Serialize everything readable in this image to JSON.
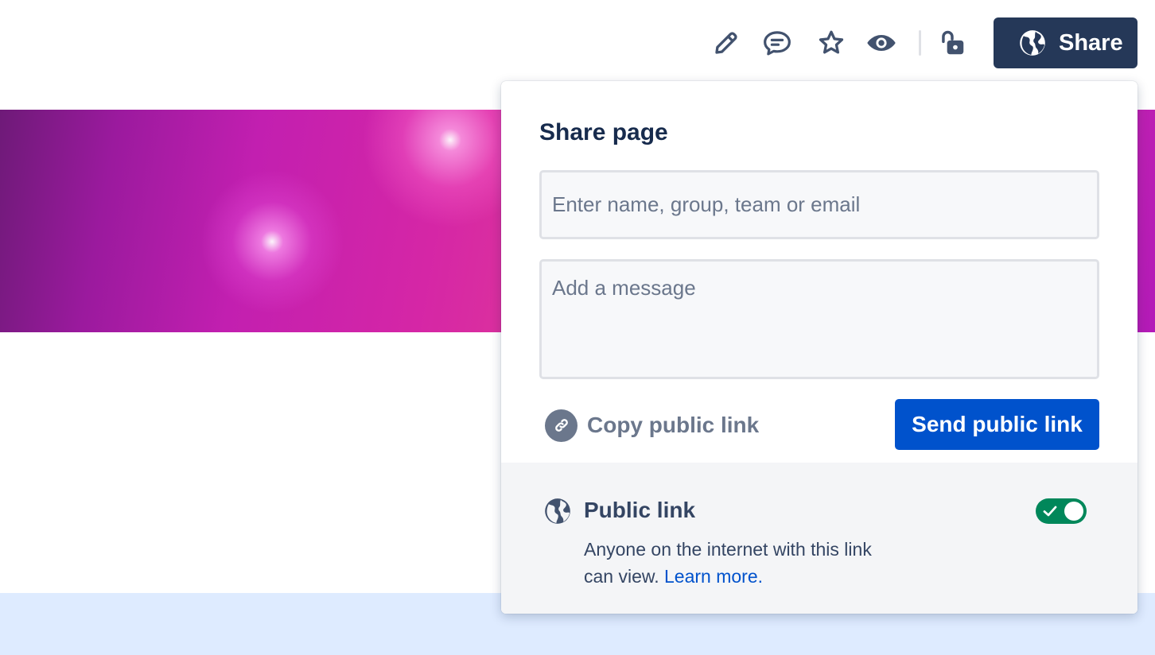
{
  "toolbar": {
    "icons": [
      "pencil-icon",
      "comment-icon",
      "star-icon",
      "eye-icon",
      "unlock-icon"
    ],
    "share_label": "Share"
  },
  "share_dialog": {
    "title": "Share page",
    "recipient_placeholder": "Enter name, group, team or email",
    "message_placeholder": "Add a message",
    "copy_link_label": "Copy public link",
    "send_button_label": "Send public link",
    "public_link": {
      "title": "Public link",
      "description": "Anyone on the internet with this link can view.",
      "learn_more": "Learn more.",
      "enabled": true
    }
  },
  "colors": {
    "primary": "#0052cc",
    "share_button": "#253858",
    "toggle_on": "#00875a",
    "text_dark": "#172b4d",
    "text_subtle": "#6b778c"
  }
}
